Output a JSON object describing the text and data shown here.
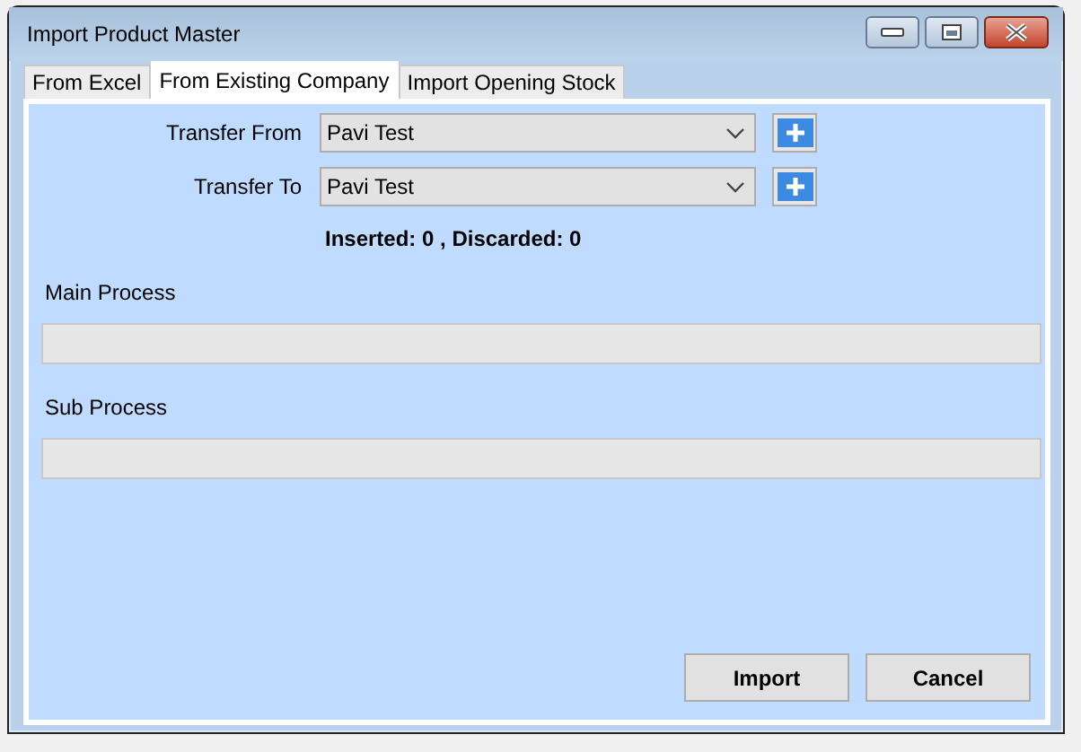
{
  "window": {
    "title": "Import Product Master"
  },
  "tabs": [
    {
      "label": "From Excel",
      "selected": false
    },
    {
      "label": "From Existing Company",
      "selected": true
    },
    {
      "label": "Import Opening Stock",
      "selected": false
    }
  ],
  "fields": [
    {
      "label": "Transfer From",
      "value": "Pavi Test"
    },
    {
      "label": "Transfer To",
      "value": "Pavi Test"
    }
  ],
  "result": "Inserted: 0 , Discarded: 0",
  "progress": [
    {
      "label": "Main Process",
      "level": 0
    },
    {
      "label": "Sub Process",
      "level": 0
    }
  ],
  "buttons": [
    "Import",
    "Cancel"
  ]
}
